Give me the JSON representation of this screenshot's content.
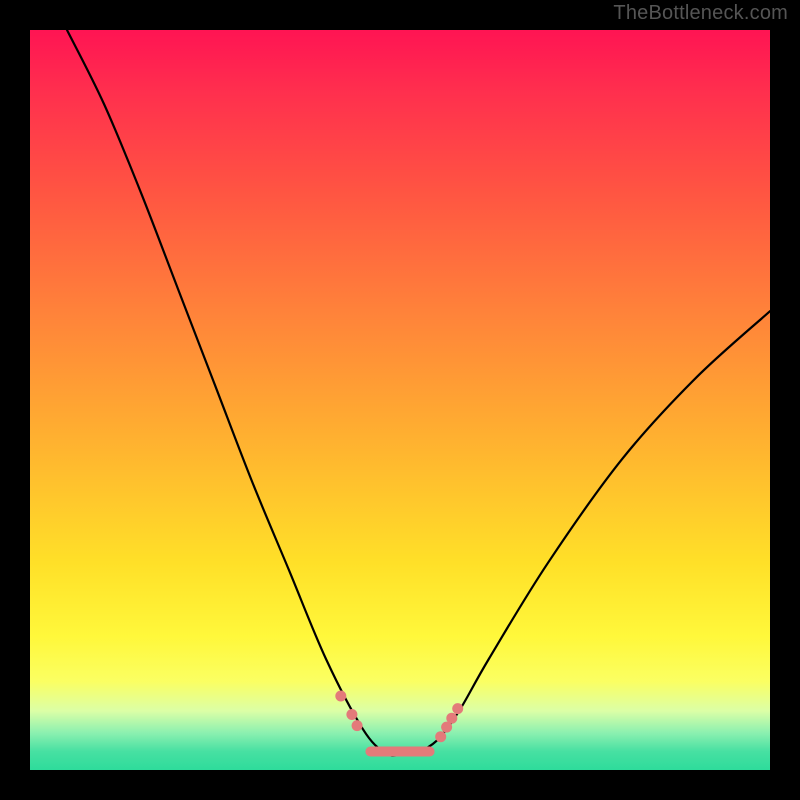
{
  "attribution": "TheBottleneck.com",
  "chart_data": {
    "type": "line",
    "title": "",
    "xlabel": "",
    "ylabel": "",
    "xlim": [
      0,
      100
    ],
    "ylim": [
      0,
      100
    ],
    "grid": false,
    "legend": false,
    "series": [
      {
        "name": "bottleneck-curve",
        "x": [
          5,
          10,
          15,
          20,
          25,
          30,
          35,
          40,
          45,
          48,
          50,
          52,
          55,
          58,
          62,
          70,
          80,
          90,
          100
        ],
        "values": [
          100,
          90,
          78,
          65,
          52,
          39,
          27,
          15,
          5.5,
          2.3,
          2.0,
          2.2,
          4.0,
          8,
          15,
          28,
          42,
          53,
          62
        ]
      }
    ],
    "highlight_points": [
      {
        "x": 42.0,
        "y": 10.0
      },
      {
        "x": 43.5,
        "y": 7.5
      },
      {
        "x": 44.2,
        "y": 6.0
      },
      {
        "x": 55.5,
        "y": 4.5
      },
      {
        "x": 56.3,
        "y": 5.8
      },
      {
        "x": 57.0,
        "y": 7.0
      },
      {
        "x": 57.8,
        "y": 8.3
      }
    ],
    "highlight_segment": {
      "x0": 46.0,
      "y0": 2.5,
      "x1": 54.0,
      "y1": 2.5
    }
  },
  "colors": {
    "background_black": "#000000",
    "curve": "#000000",
    "highlight": "#e37a7a",
    "attribution_text": "#555555"
  }
}
